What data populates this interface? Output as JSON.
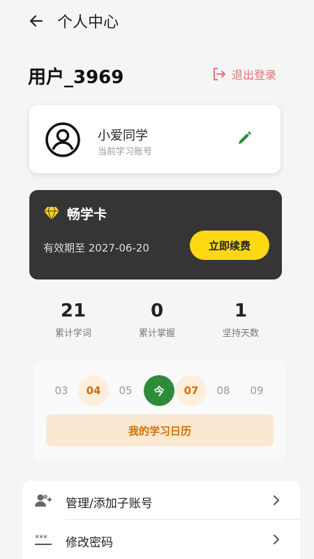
{
  "header": {
    "title": "个人中心"
  },
  "user": {
    "username": "用户_3969",
    "logout_label": "退出登录"
  },
  "account": {
    "name": "小爱同学",
    "subtitle": "当前学习账号"
  },
  "vip": {
    "title": "畅学卡",
    "expire": "有效期至 2027-06-20",
    "renew_label": "立即续费"
  },
  "stats": [
    {
      "value": "21",
      "label": "累计学词"
    },
    {
      "value": "0",
      "label": "累计掌握"
    },
    {
      "value": "1",
      "label": "坚持天数"
    }
  ],
  "calendar": {
    "days": [
      "03",
      "04",
      "05",
      "今",
      "07",
      "08",
      "09"
    ],
    "button_label": "我的学习日历"
  },
  "menu": {
    "items": [
      {
        "label": "管理/添加子账号"
      },
      {
        "label": "修改密码"
      }
    ]
  },
  "colors": {
    "accent_green": "#2e8b3a",
    "accent_orange": "#d07000",
    "logout_red": "#e07474",
    "vip_yellow": "#ffd814"
  }
}
